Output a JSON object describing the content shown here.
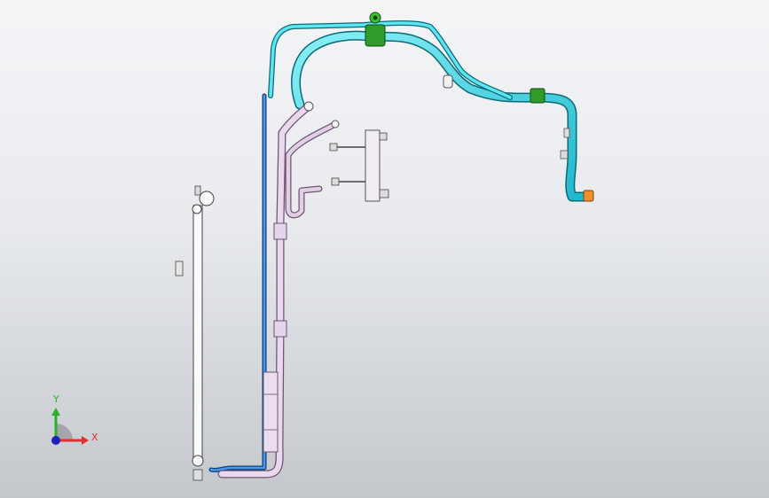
{
  "viewport": {
    "background_top": "#f4f5f7",
    "background_bottom": "#c4c7cc"
  },
  "triad": {
    "x_label": "X",
    "y_label": "Y",
    "x_color": "#e03030",
    "y_color": "#2bb02b",
    "z_color": "#2020c0"
  },
  "model": {
    "pipe_colors": {
      "cyan_hose": "#3fd8e6",
      "blue_line": "#2a78d8",
      "lavender_tube": "#d8c6de",
      "white_pipe": "#f4f4f4",
      "green_clamp": "#2f9c2a",
      "orange_fitting": "#f0902a"
    }
  }
}
